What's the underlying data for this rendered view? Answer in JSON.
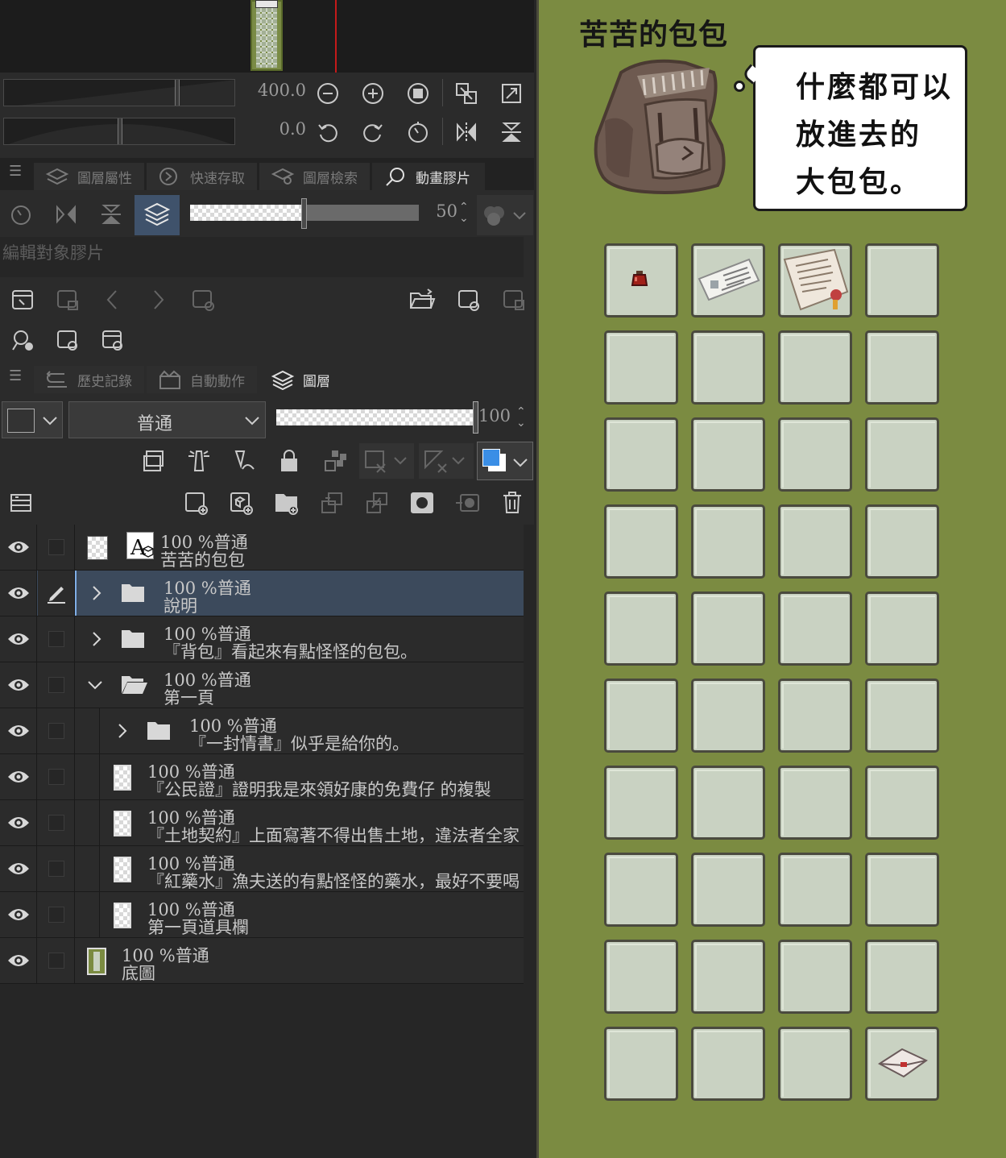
{
  "navigator": {
    "zoom_value": "400.0",
    "rotation_value": "0.0"
  },
  "panel_tabs_top": {
    "items": [
      {
        "label": "圖層屬性",
        "icon": "layer-property-icon"
      },
      {
        "label": "快速存取",
        "icon": "quick-access-icon"
      },
      {
        "label": "圖層檢索",
        "icon": "layer-search-icon"
      },
      {
        "label": "動畫膠片",
        "icon": "animation-cel-icon"
      }
    ]
  },
  "animation": {
    "opacity_value": "50",
    "target_placeholder": "編輯對象膠片"
  },
  "panel_tabs_bottom": {
    "items": [
      {
        "label": "歷史記錄",
        "icon": "history-icon"
      },
      {
        "label": "自動動作",
        "icon": "auto-action-icon"
      },
      {
        "label": "圖層",
        "icon": "layer-icon"
      }
    ]
  },
  "layer_panel": {
    "blend_mode": "普通",
    "opacity_value": "100"
  },
  "layers": [
    {
      "meta": "100 %普通",
      "name": "苦苦的包包",
      "kind": "text"
    },
    {
      "meta": "100 %普通",
      "name": "說明",
      "kind": "folder",
      "expanded": false,
      "selected": true
    },
    {
      "meta": "100 %普通",
      "name": "『背包』看起來有點怪怪的包包。",
      "kind": "folder",
      "expanded": false
    },
    {
      "meta": "100 %普通",
      "name": "第一頁",
      "kind": "folder",
      "expanded": true
    },
    {
      "meta": "100 %普通",
      "name": "『一封情書』似乎是給你的。",
      "kind": "folder",
      "expanded": false
    },
    {
      "meta": "100 %普通",
      "name": "『公民證』證明我是來領好康的免費仔 的複製",
      "kind": "raster"
    },
    {
      "meta": "100 %普通",
      "name": "『土地契約』上面寫著不得出售土地，違法者全家爛ㄐㄐ",
      "kind": "raster"
    },
    {
      "meta": "100 %普通",
      "name": "『紅藥水』漁夫送的有點怪怪的藥水，最好不要喝。",
      "kind": "raster"
    },
    {
      "meta": "100 %普通",
      "name": "第一頁道具欄",
      "kind": "raster"
    },
    {
      "meta": "100 %普通",
      "name": "底圖",
      "kind": "raster"
    }
  ],
  "canvas": {
    "title": "苦苦的包包",
    "bubble_text": "什麼都可以\n放進去的\n大包包。",
    "colors": {
      "background": "#7b8b41",
      "slot": "#c9d2c2"
    },
    "grid": {
      "columns": 4,
      "rows": 10
    },
    "items": [
      {
        "slot": 0,
        "icon": "red-potion-icon"
      },
      {
        "slot": 1,
        "icon": "citizen-card-icon"
      },
      {
        "slot": 2,
        "icon": "land-contract-scroll-icon"
      },
      {
        "slot": 39,
        "icon": "love-letter-icon"
      }
    ]
  }
}
